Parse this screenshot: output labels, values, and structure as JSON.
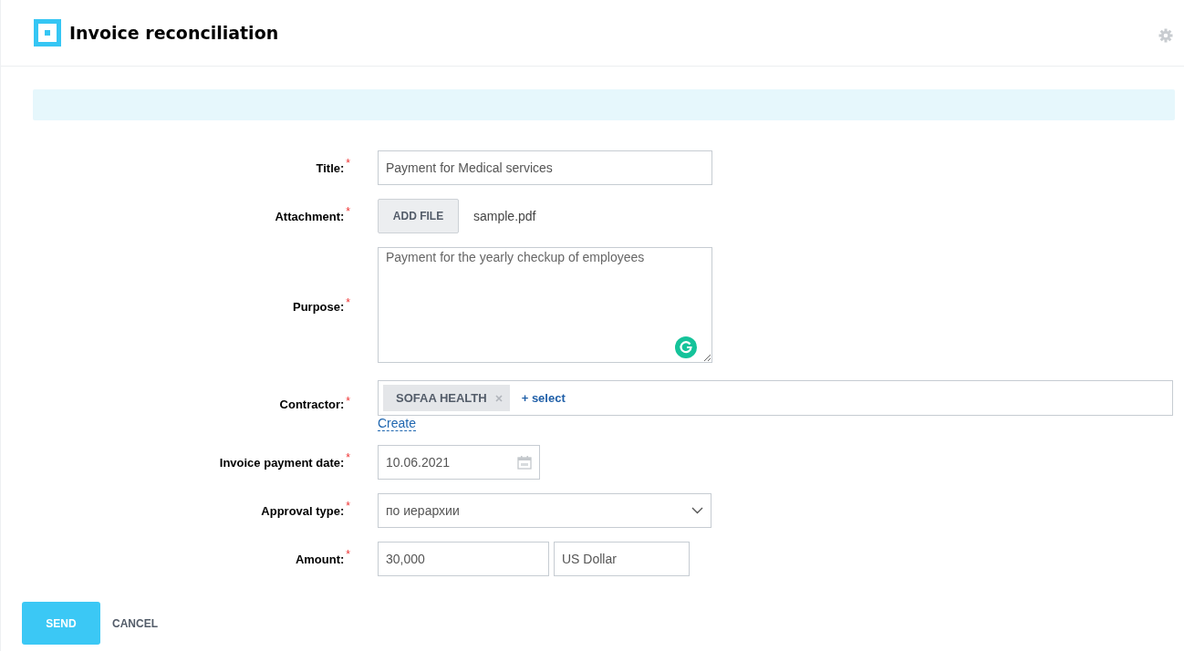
{
  "header": {
    "title": "Invoice reconciliation"
  },
  "form": {
    "fields": [
      {
        "kind": "text",
        "label": "Title:",
        "required_mark": "*",
        "value": "Payment for Medical services"
      },
      {
        "kind": "file",
        "label": "Attachment:",
        "required_mark": "*",
        "button": "ADD FILE",
        "file_name": "sample.pdf"
      },
      {
        "kind": "textarea",
        "label": "Purpose:",
        "required_mark": "*",
        "value": "Payment for the yearly checkup of employees"
      },
      {
        "kind": "tags",
        "label": "Contractor:",
        "required_mark": "*",
        "tags": [
          "SOFAA HEALTH"
        ],
        "select_link": "+ select",
        "create_link": "Create"
      },
      {
        "kind": "date",
        "label": "Invoice payment date:",
        "required_mark": "*",
        "value": "10.06.2021"
      },
      {
        "kind": "select",
        "label": "Approval type:",
        "required_mark": "*",
        "value": "по иерархии"
      },
      {
        "kind": "amount",
        "label": "Amount:",
        "required_mark": "*",
        "value": "30,000",
        "currency": "US Dollar"
      }
    ]
  },
  "actions": {
    "primary": "SEND",
    "secondary": "CANCEL"
  }
}
